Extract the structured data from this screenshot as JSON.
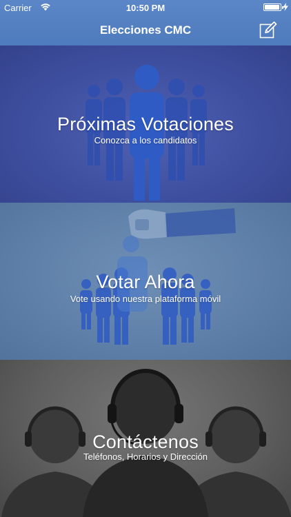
{
  "status_bar": {
    "carrier": "Carrier",
    "time": "10:50 PM",
    "wifi_icon": "wifi-icon",
    "battery_icon": "battery-icon",
    "charging_icon": "bolt-icon"
  },
  "nav": {
    "title": "Elecciones CMC",
    "compose_icon": "compose-icon"
  },
  "panels": [
    {
      "title": "Próximas Votaciones",
      "subtitle": "Conozca a los candidatos",
      "icon": "people-group-icon",
      "color": "#3f4fa0"
    },
    {
      "title": "Votar Ahora",
      "subtitle": "Vote usando nuestra plataforma móvil",
      "icon": "ballot-hand-icon",
      "color": "#5e7fa8"
    },
    {
      "title": "Contáctenos",
      "subtitle": "Teléfonos, Horarios y Dirección",
      "icon": "headset-agents-icon",
      "color": "#5f5f5f"
    }
  ]
}
